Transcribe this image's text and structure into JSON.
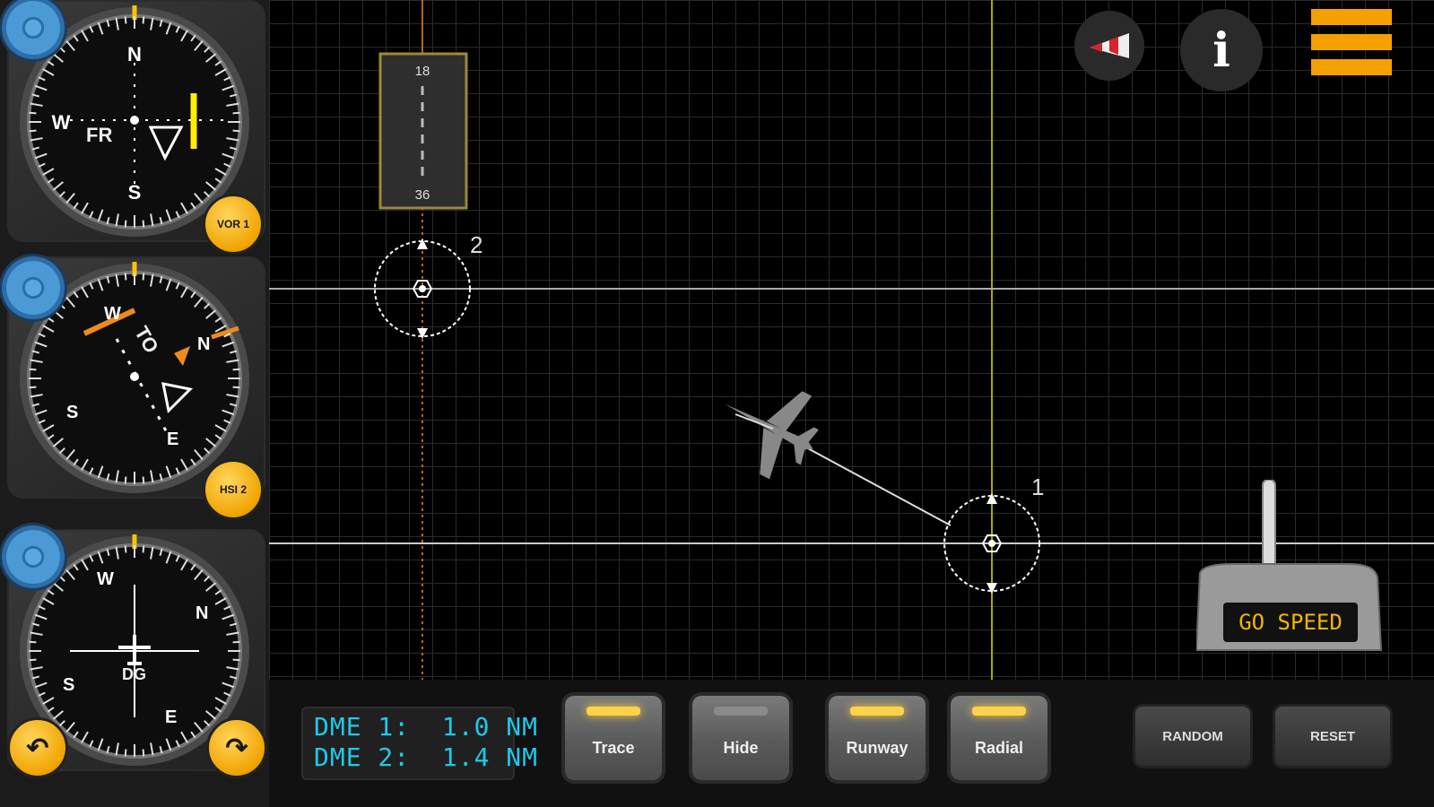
{
  "instruments": {
    "vor1": {
      "button_label": "VOR 1",
      "flag": "FR"
    },
    "hsi2": {
      "button_label": "HSI 2",
      "flag": "TO"
    },
    "dg": {
      "center_label": "DG",
      "rotate_left": "↶",
      "rotate_right": "↷"
    }
  },
  "top_bar": {
    "wind_icon": "windsock-icon",
    "info_label": "i",
    "menu_icon": "hamburger-menu-icon"
  },
  "map": {
    "runway": {
      "top_number": "18",
      "bottom_number": "36"
    },
    "station1_label": "1",
    "station2_label": "2"
  },
  "throttle": {
    "label": "GO SPEED"
  },
  "bottom": {
    "dme1": "DME 1:  1.0 NM",
    "dme2": "DME 2:  1.4 NM",
    "toggles": [
      {
        "label": "Trace",
        "lamp": "on"
      },
      {
        "label": "Hide",
        "lamp": "off"
      },
      {
        "label": "Runway",
        "lamp": "on"
      },
      {
        "label": "Radial",
        "lamp": "on"
      }
    ],
    "random_label": "RANDOM",
    "reset_label": "RESET"
  },
  "colors": {
    "accent": "#f5a000",
    "dme": "#22c8e8",
    "lamp_on": "#ffd24a"
  }
}
